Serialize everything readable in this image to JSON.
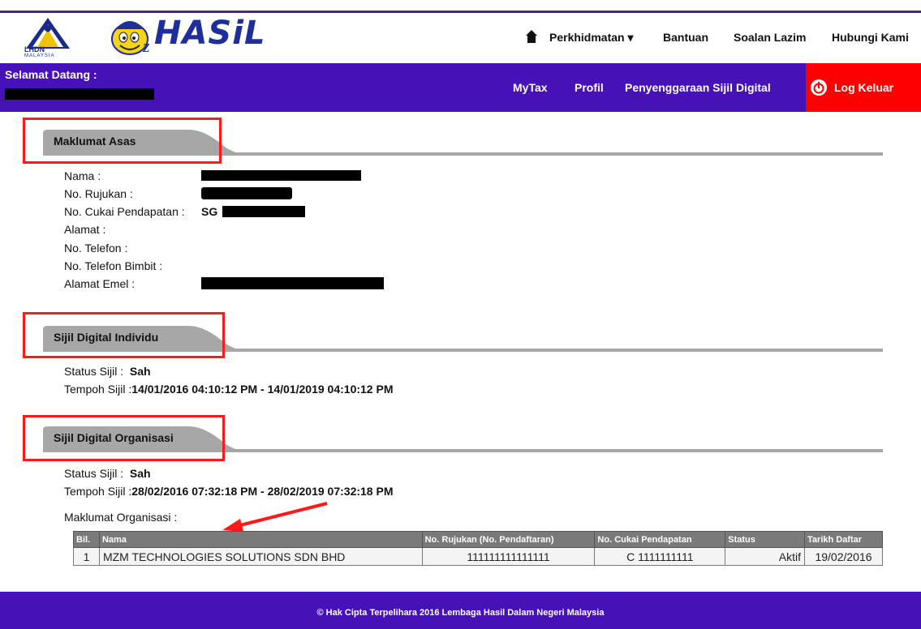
{
  "header": {
    "lhdn_text": "LHDN",
    "lhdn_sub": "MALAYSIA",
    "brand": "HASiL",
    "nav": [
      {
        "label": "Perkhidmatan ▾"
      },
      {
        "label": "Bantuan"
      },
      {
        "label": "Soalan Lazim"
      },
      {
        "label": "Hubungi Kami"
      }
    ]
  },
  "bar": {
    "welcome": "Selamat Datang :",
    "nav": [
      {
        "label": "MyTax"
      },
      {
        "label": "Profil"
      },
      {
        "label": "Penyenggaraan Sijil Digital"
      }
    ],
    "logout": "Log Keluar"
  },
  "sections": {
    "asas": {
      "title": "Maklumat Asas",
      "nama": "Nama :",
      "rujukan": "No. Rujukan :",
      "cukai": "No. Cukai Pendapatan :",
      "cukai_prefix": "SG",
      "alamat": "Alamat :",
      "telefon": "No. Telefon :",
      "bimbit": "No. Telefon Bimbit :",
      "emel": "Alamat Emel :"
    },
    "individu": {
      "title": "Sijil Digital Individu",
      "status_label": "Status Sijil :",
      "status_value": "Sah",
      "tempoh_label": "Tempoh Sijil :",
      "tempoh_value": "14/01/2016 04:10:12 PM - 14/01/2019 04:10:12 PM"
    },
    "organisasi": {
      "title": "Sijil Digital Organisasi",
      "status_label": "Status Sijil :",
      "status_value": "Sah",
      "tempoh_label": "Tempoh Sijil :",
      "tempoh_value": "28/02/2016 07:32:18 PM - 28/02/2019 07:32:18 PM",
      "maklumat_label": "Maklumat Organisasi :"
    }
  },
  "org_table": {
    "headers": [
      "Bil.",
      "Nama",
      "No. Rujukan (No. Pendaftaran)",
      "No. Cukai Pendapatan",
      "Status",
      "Tarikh Daftar"
    ],
    "rows": [
      [
        "1",
        "MZM TECHNOLOGIES SOLUTIONS SDN BHD",
        "111111111111111",
        "C 1111111111",
        "Aktif",
        "19/02/2016"
      ]
    ]
  },
  "footer": {
    "text": "© Hak Cipta Terpelihara 2016 Lembaga Hasil Dalam Negeri Malaysia"
  },
  "colors": {
    "purple": "#4612b8",
    "logout_red": "#ff0000",
    "annotation_red": "#ff1a1a",
    "section_gray": "#a7a7a7"
  },
  "icons": {
    "home": "home-icon",
    "logout": "power-icon"
  }
}
